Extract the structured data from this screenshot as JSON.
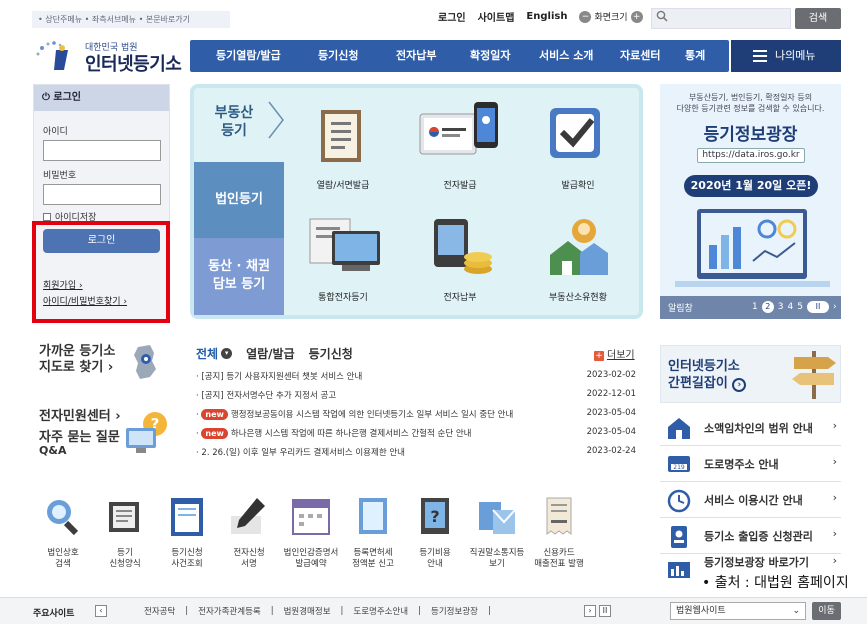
{
  "header": {
    "skip_links": "• 상단주메뉴 • 좌측서브메뉴 • 본문바로가기",
    "login": "로그인",
    "sitemap": "사이트맵",
    "english": "English",
    "zoom_label": "화면크기",
    "search_placeholder": "",
    "search_button": "검색",
    "logo_sub": "대한민국 법원",
    "logo_main": "인터넷등기소"
  },
  "nav": {
    "items": [
      "등기열람/발급",
      "등기신청",
      "전자납부",
      "확정일자",
      "서비스 소개",
      "자료센터",
      "통계"
    ],
    "my_menu": "나의메뉴"
  },
  "login_panel": {
    "title": "로그인",
    "id_label": "아이디",
    "pw_label": "비밀번호",
    "remember": "아이디저장",
    "button": "로그인",
    "signup": "회원가입",
    "find": "아이디/비밀번호찾기"
  },
  "hero": {
    "tabs": [
      "부동산 등기",
      "법인등기",
      "동산 · 채권 담보 등기"
    ],
    "services": [
      "열람/서면발급",
      "전자발급",
      "발급확인",
      "통합전자등기",
      "전자납부",
      "부동산소유현황"
    ]
  },
  "banner": {
    "top_line1": "부동산등기, 법인등기, 확정일자 등의",
    "top_line2": "다양한 등기관련 정보를 검색할 수 있습니다.",
    "title": "등기정보광장",
    "url": "https://data.iros.go.kr",
    "date_text": "2020년 1월 20일 오픈!",
    "alert": "알림창",
    "pages": [
      "1",
      "2",
      "3",
      "4",
      "5"
    ],
    "pause": "II"
  },
  "left_bottom": {
    "registry_line1": "가까운 등기소",
    "registry_line2": "지도로 찾기 ›",
    "civil": "전자민원센터 ›",
    "faq_line1": "자주 묻는 질문",
    "faq_line2": "Q&A"
  },
  "notices": {
    "tabs": [
      "전체",
      "열람/발급",
      "등기신청"
    ],
    "more": "더보기",
    "rows": [
      {
        "new": false,
        "title": "[공지] 등기 사용자지원센터 챗봇 서비스 안내",
        "date": "2023-02-02"
      },
      {
        "new": false,
        "title": "[공지] 전자서명수단 추가 지정서 공고",
        "date": "2022-12-01"
      },
      {
        "new": true,
        "title": "행정정보공동이용 시스템 작업에 의한 인터넷등기소 일부 서비스 일시 중단 안내",
        "date": "2023-05-04"
      },
      {
        "new": true,
        "title": "하나은행 시스템 작업에 따른 하나은행 결제서비스 간헐적 순단 안내",
        "date": "2023-05-04"
      },
      {
        "new": false,
        "title": "2. 26.(일) 이후 일부 우리카드 결제서비스 이용제한 안내",
        "date": "2023-02-24"
      }
    ],
    "new_badge": "new"
  },
  "right_list": {
    "shortcut_line1": "인터넷등기소",
    "shortcut_line2": "간편길잡이",
    "items": [
      "소액임차인의 범위 안내",
      "도로명주소 안내",
      "서비스 이용시간 안내",
      "등기소 출입증 신청관리",
      "등기정보광장 바로가기"
    ],
    "source": "• 출처 : 대법원 홈페이지"
  },
  "bottom_icons": [
    {
      "l1": "법인상호",
      "l2": "검색"
    },
    {
      "l1": "등기",
      "l2": "신청양식"
    },
    {
      "l1": "등기신청",
      "l2": "사건조회"
    },
    {
      "l1": "전자신청",
      "l2": "서명"
    },
    {
      "l1": "법인인감증명서",
      "l2": "발급예약"
    },
    {
      "l1": "등록면허세",
      "l2": "정액분 신고"
    },
    {
      "l1": "등기비용",
      "l2": "안내"
    },
    {
      "l1": "직권말소통지등",
      "l2": "보기"
    },
    {
      "l1": "신용카드",
      "l2": "매출전표 발행"
    }
  ],
  "footer": {
    "title": "주요사이트",
    "links": [
      "전자공탁",
      "전자가족관계등록",
      "법원경매정보",
      "도로명주소안내",
      "등기정보광장"
    ],
    "select": "법원웹사이트",
    "go": "이동"
  },
  "colors": {
    "nav": "#2f5da8",
    "highlight": "#e3000f",
    "accent": "#1f3e77"
  }
}
